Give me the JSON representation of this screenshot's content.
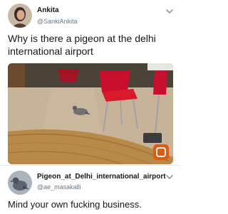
{
  "tweet": {
    "author_name": "Ankita",
    "author_handle": "@SankiAnkita",
    "text": "Why is there a pigeon at the delhi international airport",
    "menu_icon": "chevron-down-icon",
    "media": {
      "description_icon": "photo"
    }
  },
  "reply": {
    "author_name": "Pigeon_at_Delhi_international_airport",
    "author_handle": "@ae_masakalli",
    "text": "Mind your own fucking business.",
    "menu_icon": "chevron-down-icon"
  }
}
